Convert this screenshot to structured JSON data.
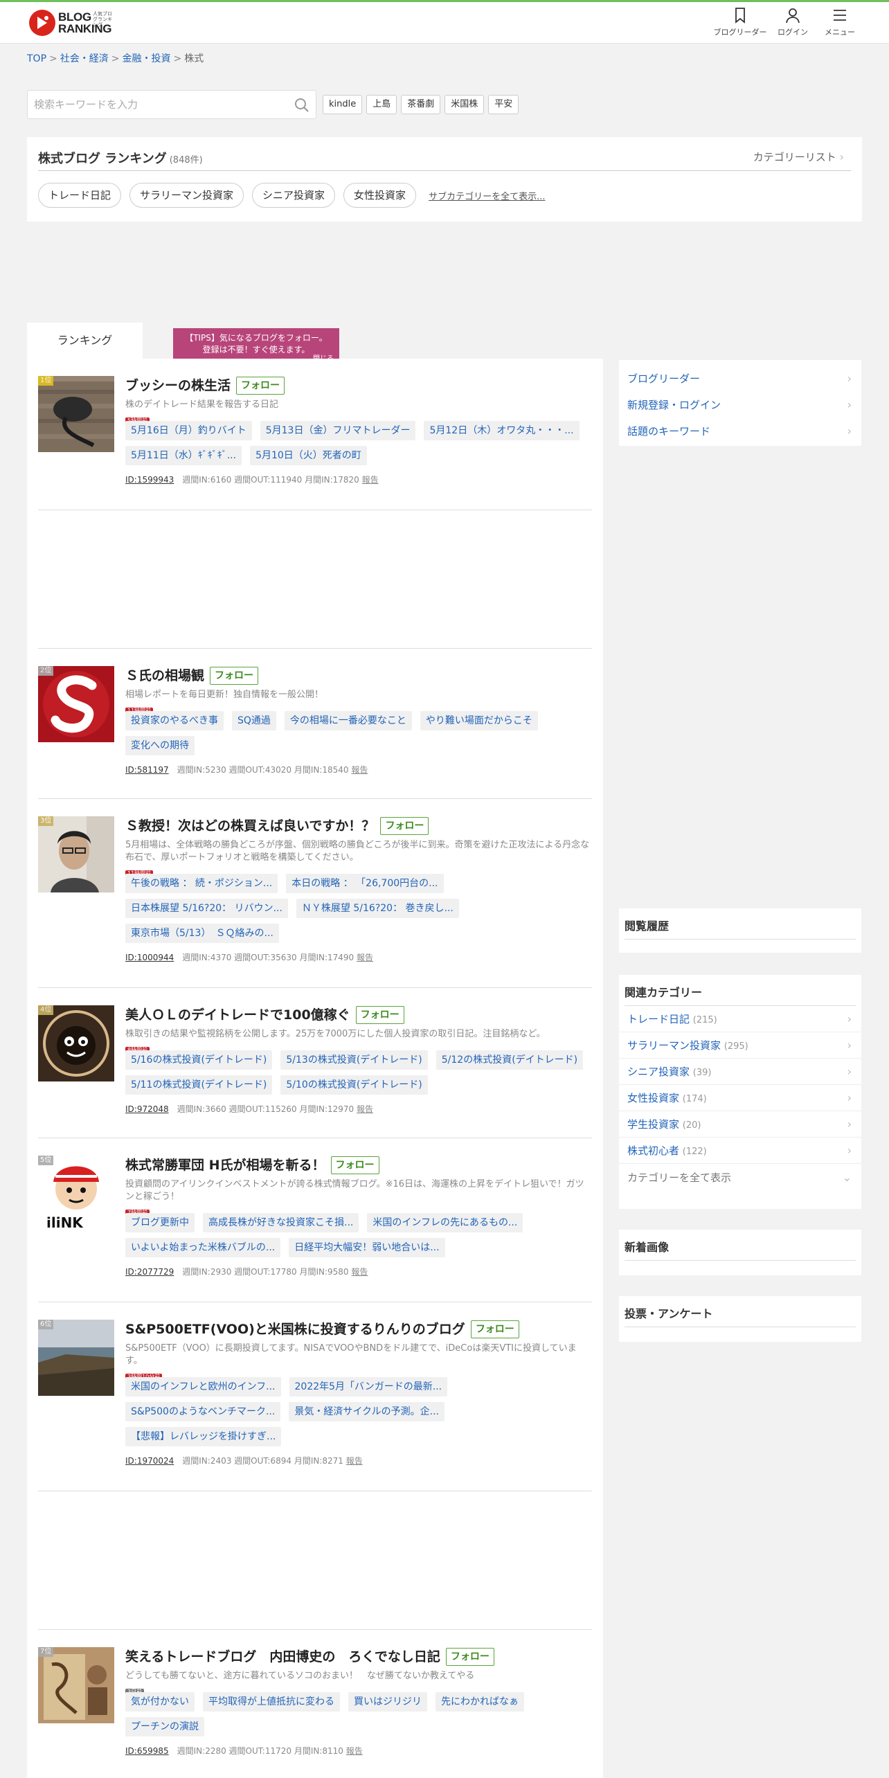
{
  "header": {
    "logo_line1": "BLOG",
    "logo_line2": "RANKING",
    "logo_small": "人気ブログランキング",
    "nav": [
      "ブログリーダー",
      "ログイン",
      "メニュー"
    ]
  },
  "breadcrumb": [
    "TOP",
    "社会・経済",
    "金融・投資",
    "株式"
  ],
  "search": {
    "placeholder": "検索キーワードを入力",
    "keywords": [
      "kindle",
      "上島",
      "茶番劇",
      "米国株",
      "平安"
    ]
  },
  "category": {
    "title": "株式ブログ ランキング",
    "count": "(848件)",
    "list_link": "カテゴリーリスト",
    "subcats": [
      "トレード日記",
      "サラリーマン投資家",
      "シニア投資家",
      "女性投資家"
    ],
    "all_sub": "サブカテゴリーを全て表示..."
  },
  "tab": "ランキング",
  "tips": {
    "line1": "【TIPS】気になるブログをフォロー。",
    "line2": "登録は不要！すぐ使えます。",
    "close": "閉じる"
  },
  "follow_label": "フォロー",
  "report_label": "報告",
  "entries": [
    {
      "rank": "1位",
      "title": "ブッシーの株生活",
      "desc": "株のデイトレード結果を報告する日記",
      "ago": "5時間前",
      "posts": [
        "5月16日（月）釣りバイト",
        "5月13日（金）フリマトレーダー",
        "5月12日（木）オワタ丸・・・...",
        "5月11日（水）ｷﾞｷﾞｷﾞ...",
        "5月10日（火）死者の町"
      ],
      "id": "ID:1599943",
      "stats": "週間IN:6160 週間OUT:111940 月間IN:17820"
    },
    {
      "rank": "2位",
      "title": "Ｓ氏の相場観",
      "desc": "相場レポートを毎日更新！独自情報を一般公開！",
      "ago": "11時間前",
      "posts": [
        "投資家のやるべき事",
        "SQ通過",
        "今の相場に一番必要なこと",
        "やり難い場面だからこそ",
        "変化への期待"
      ],
      "id": "ID:581197",
      "stats": "週間IN:5230 週間OUT:43020 月間IN:18540"
    },
    {
      "rank": "3位",
      "title": "Ｓ教授！次はどの株買えば良いですか！？",
      "desc": "5月相場は、全体戦略の勝負どころが序盤、個別戦略の勝負どころが後半に到来。奇策を避けた正攻法による丹念な布石で、厚いポートフォリオと戦略を構築してください。",
      "ago": "11時間前",
      "posts": [
        "午後の戦略 ： 続・ポジション...",
        "本日の戦略 ： 「26,700円台の...",
        "日本株展望 5/16?20： リバウン...",
        "ＮＹ株展望 5/16?20： 巻き戻し...",
        "東京市場（5/13）　ＳＱ絡みの..."
      ],
      "id": "ID:1000944",
      "stats": "週間IN:4370 週間OUT:35630 月間IN:17490"
    },
    {
      "rank": "4位",
      "title": "美人ＯＬのデイトレードで100億稼ぐ",
      "desc": "株取引きの結果や監視銘柄を公開します。25万を7000万にした個人投資家の取引日記。注目銘柄など。",
      "ago": "8時間前",
      "posts": [
        "5/16の株式投資(デイトレード)",
        "5/13の株式投資(デイトレード)",
        "5/12の株式投資(デイトレード)",
        "5/11の株式投資(デイトレード)",
        "5/10の株式投資(デイトレード)"
      ],
      "id": "ID:972048",
      "stats": "週間IN:3660 週間OUT:115260 月間IN:12970"
    },
    {
      "rank": "5位",
      "title": "株式常勝軍団 H氏が相場を斬る！",
      "desc": "投資顧問のアイリンクインベストメントが誇る株式情報ブログ。※16日は、海運株の上昇をデイトレ狙いで！ガツンと稼ごう！",
      "ago": "7時間前",
      "posts": [
        "ブログ更新中",
        "高成長株が好きな投資家こそ損...",
        "米国のインフレの先にあるもの...",
        "いよいよ始まった米株バブルの...",
        "日経平均大幅安！弱い地合いは..."
      ],
      "id": "ID:2077729",
      "stats": "週間IN:2930 週間OUT:17780 月間IN:9580"
    },
    {
      "rank": "6位",
      "title": "S&P500ETF(VOO)と米国株に投資するりんりのブログ",
      "desc": "S&P500ETF（VOO）に長期投資してます。NISAでVOOやBNDをドル建てで、iDeCoは楽天VTIに投資しています。",
      "ago": "3時間10分前",
      "posts": [
        "米国のインフレと欧州のインフ...",
        "2022年5月「バンガードの最新...",
        "S&P500のようなベンチマーク...",
        "景気・経済サイクルの予測。企...",
        "【悲報】レバレッジを掛けすぎ..."
      ],
      "id": "ID:1970024",
      "stats": "週間IN:2403 週間OUT:6894 月間IN:8271"
    },
    {
      "rank": "7位",
      "title": "笑えるトレードブログ　内田博史の　ろくでなし日記",
      "desc": "どうしても勝てないと、途方に暮れているソコのおまい！　なぜ勝てないか教えてやる",
      "ago": "3日前",
      "posts": [
        "気が付かない",
        "平均取得が上値抵抗に変わる",
        "買いはジリジリ",
        "先にわかればなぁ",
        "プーチンの演説"
      ],
      "id": "ID:659985",
      "stats": "週間IN:2280 週間OUT:11720 月間IN:8110"
    }
  ],
  "sidebar": {
    "links": [
      "ブログリーダー",
      "新規登録・ログイン",
      "話題のキーワード"
    ],
    "history_title": "閲覧履歴",
    "related_title": "関連カテゴリー",
    "related": [
      {
        "name": "トレード日記",
        "count": "(215)"
      },
      {
        "name": "サラリーマン投資家",
        "count": "(295)"
      },
      {
        "name": "シニア投資家",
        "count": "(39)"
      },
      {
        "name": "女性投資家",
        "count": "(174)"
      },
      {
        "name": "学生投資家",
        "count": "(20)"
      },
      {
        "name": "株式初心者",
        "count": "(122)"
      }
    ],
    "related_all": "カテゴリーを全て表示",
    "new_images_title": "新着画像",
    "poll_title": "投票・アンケート"
  }
}
